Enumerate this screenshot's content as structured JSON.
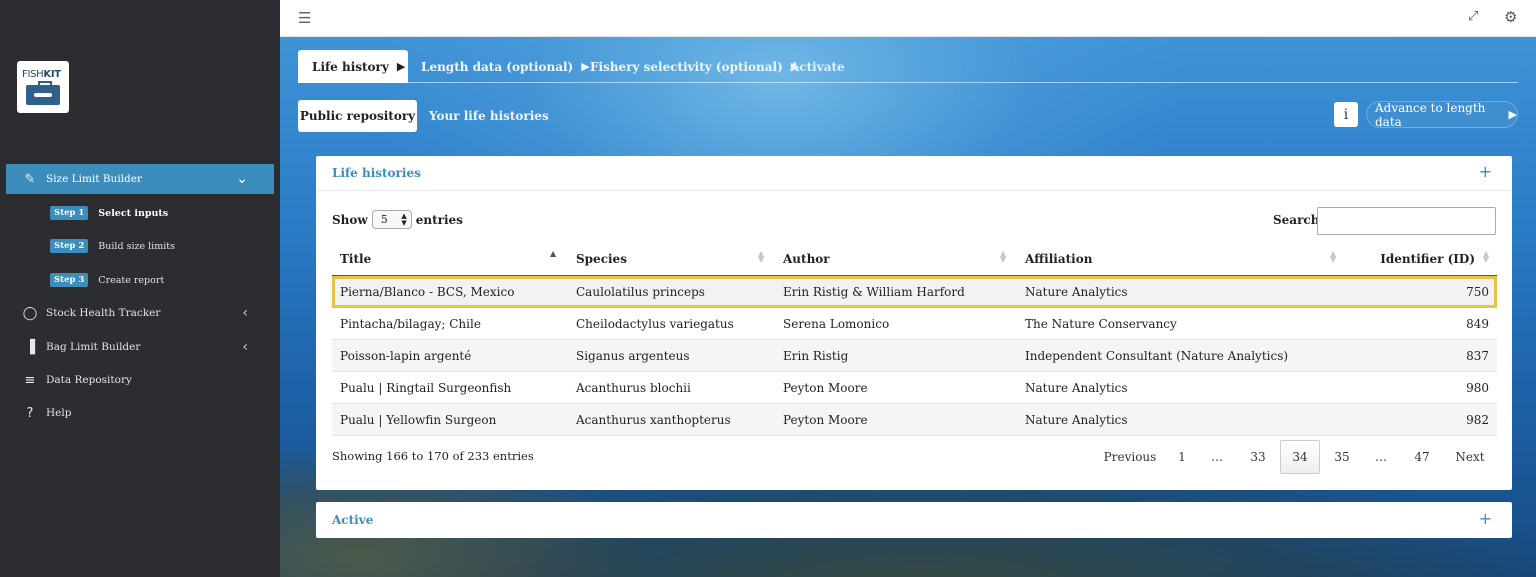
{
  "app": {
    "logo_text_a": "FISH",
    "logo_text_b": "KIT"
  },
  "sidebar": {
    "items": [
      {
        "label": "Size Limit Builder",
        "icon": "ruler-icon"
      },
      {
        "label": "Stock Health Tracker",
        "icon": "circle-notch-icon"
      },
      {
        "label": "Bag Limit Builder",
        "icon": "bar-chart-icon"
      },
      {
        "label": "Data Repository",
        "icon": "database-icon"
      },
      {
        "label": "Help",
        "icon": "question-icon"
      }
    ],
    "steps": [
      {
        "badge": "Step 1",
        "label": "Select inputs"
      },
      {
        "badge": "Step 2",
        "label": "Build size limits"
      },
      {
        "badge": "Step 3",
        "label": "Create report"
      }
    ]
  },
  "tabs": [
    {
      "label": "Life history"
    },
    {
      "label": "Length data (optional)"
    },
    {
      "label": "Fishery selectivity (optional)"
    },
    {
      "label": "Activate"
    }
  ],
  "subtabs": {
    "public": "Public repository",
    "yours": "Your life histories"
  },
  "buttons": {
    "info": "i",
    "advance": "Advance to length data"
  },
  "life_histories": {
    "title": "Life histories",
    "show_label": "Show",
    "entries_value": "5",
    "entries_label": "entries",
    "search_label": "Search:",
    "search_value": "",
    "columns": [
      "Title",
      "Species",
      "Author",
      "Affiliation",
      "Identifier (ID)"
    ],
    "rows": [
      {
        "title": "Pierna/Blanco - BCS, Mexico",
        "species": "Caulolatilus princeps",
        "author": "Erin Ristig & William Harford",
        "affiliation": "Nature Analytics",
        "id": "750"
      },
      {
        "title": "Pintacha/bilagay; Chile",
        "species": "Cheilodactylus variegatus",
        "author": "Serena Lomonico",
        "affiliation": "The Nature Conservancy",
        "id": "849"
      },
      {
        "title": "Poisson-lapin argenté",
        "species": "Siganus argenteus",
        "author": "Erin Ristig",
        "affiliation": "Independent Consultant (Nature Analytics)",
        "id": "837"
      },
      {
        "title": "Pualu | Ringtail Surgeonfish",
        "species": "Acanthurus blochii",
        "author": "Peyton Moore",
        "affiliation": "Nature Analytics",
        "id": "980"
      },
      {
        "title": "Pualu | Yellowfin Surgeon",
        "species": "Acanthurus xanthopterus",
        "author": "Peyton Moore",
        "affiliation": "Nature Analytics",
        "id": "982"
      }
    ],
    "info": "Showing 166 to 170 of 233 entries",
    "pagination": {
      "previous": "Previous",
      "pages": [
        "1",
        "…",
        "33",
        "34",
        "35",
        "…",
        "47"
      ],
      "current": "34",
      "next": "Next"
    }
  },
  "active": {
    "title": "Active"
  },
  "colors": {
    "accent": "#3c8dbc",
    "sidebar_bg": "#2b2d30",
    "highlight": "#e5c542"
  }
}
